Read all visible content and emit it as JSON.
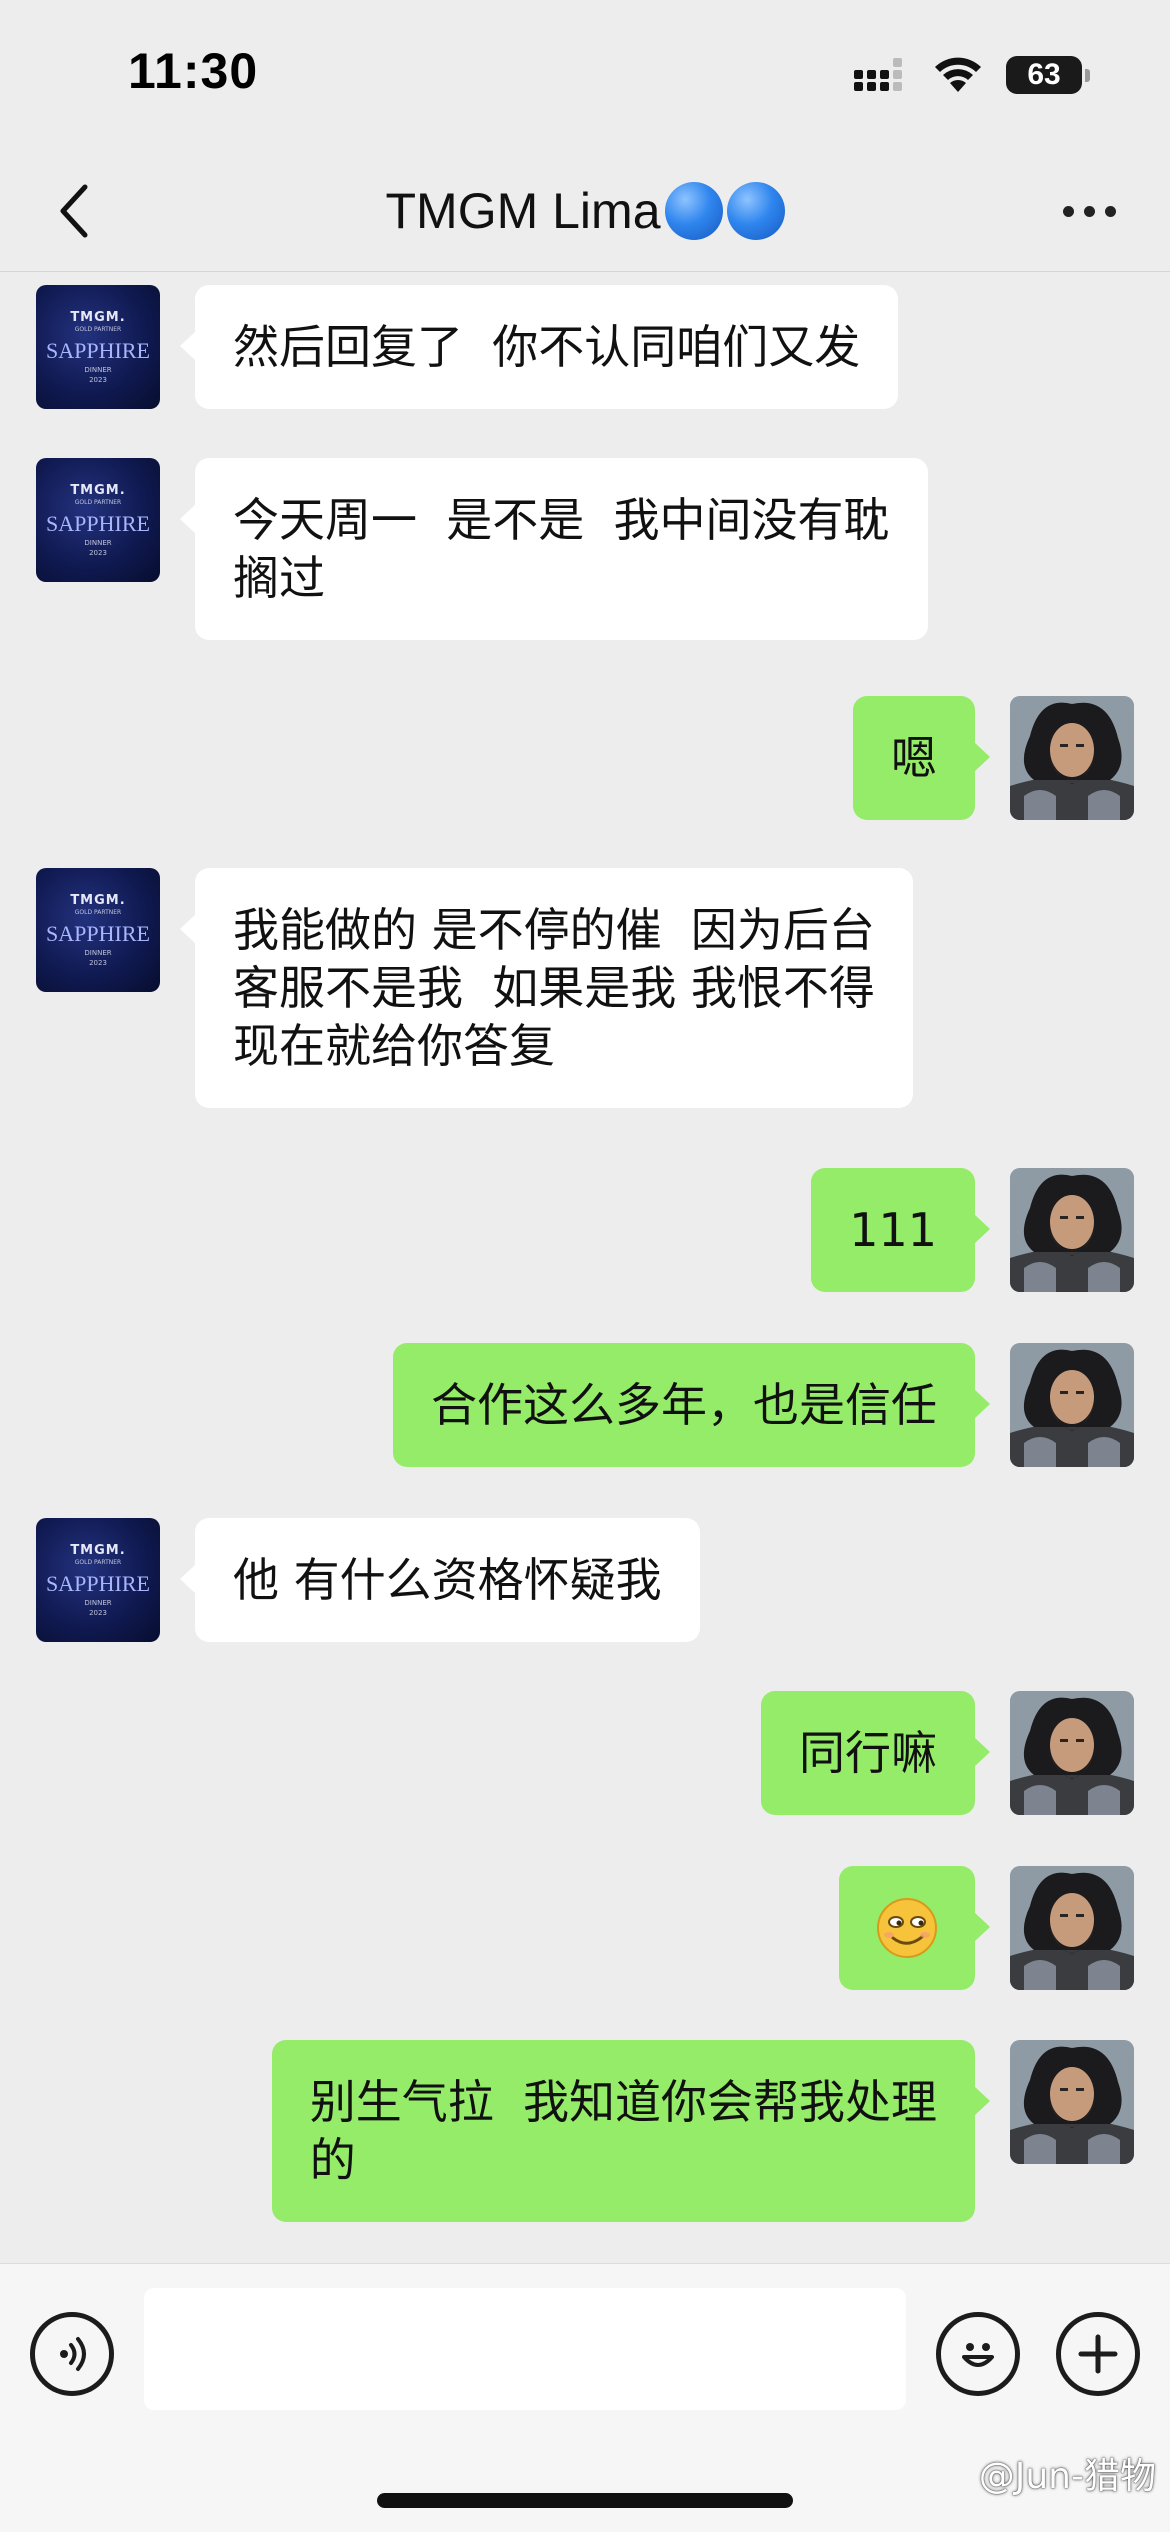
{
  "status_bar": {
    "time": "11:30",
    "battery": "63",
    "icons": [
      "cellular-signal-icon",
      "wifi-icon",
      "battery-icon"
    ]
  },
  "nav": {
    "title": "TMGM Lima",
    "title_emoji_color": "#2f86ee",
    "back_icon": "chevron-left-icon",
    "more_icon": "more-horizontal-icon"
  },
  "contact_avatar": {
    "brand": "TMGM.",
    "tagline": "GOLD PARTNER",
    "name": "SAPPHIRE",
    "event": "DINNER",
    "year": "2023"
  },
  "messages": [
    {
      "side": "in",
      "text": "然后回复了  你不认同咱们又发"
    },
    {
      "side": "in",
      "text": "今天周一  是不是  我中间没有耽\n搁过"
    },
    {
      "side": "out",
      "text": "嗯"
    },
    {
      "side": "in",
      "text": "我能做的 是不停的催  因为后台\n客服不是我  如果是我 我恨不得\n现在就给你答复"
    },
    {
      "side": "out",
      "text": "111"
    },
    {
      "side": "out",
      "text": "合作这么多年，也是信任"
    },
    {
      "side": "in",
      "text": "他 有什么资格怀疑我"
    },
    {
      "side": "out",
      "text": "同行嘛"
    },
    {
      "side": "out",
      "text": "",
      "emoji": "smirk-emoji"
    },
    {
      "side": "out",
      "text": "别生气拉  我知道你会帮我处理\n的"
    }
  ],
  "input_bar": {
    "voice_icon": "voice-icon",
    "emoji_icon": "emoji-face-icon",
    "plus_icon": "plus-icon",
    "input_value": ""
  },
  "watermark": "@Jun-猎物",
  "colors": {
    "background": "#ededed",
    "incoming_bubble": "#ffffff",
    "outgoing_bubble": "#95ec69"
  }
}
